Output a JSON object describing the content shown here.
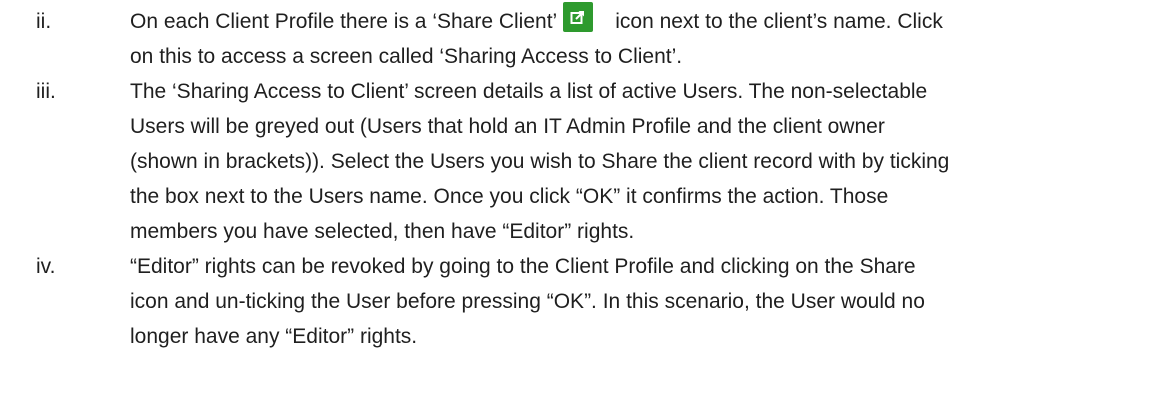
{
  "items": [
    {
      "numeral": "ii.",
      "lines": [
        {
          "before_icon": "On each Client Profile there is a ‘Share Client’",
          "icon": "share-icon",
          "after_icon": "icon next to the client’s name. Click"
        },
        "on this to access a screen called ‘Sharing Access to Client’."
      ]
    },
    {
      "numeral": "iii.",
      "lines": [
        "The ‘Sharing Access to Client’ screen details a list of active Users. The non-selectable",
        "Users will be greyed out (Users that hold an IT Admin Profile and the client owner",
        "(shown in brackets)). Select the Users you wish to Share the client record with by ticking",
        "the box next to the Users name. Once you click “OK” it confirms the action. Those",
        "members you have selected, then have “Editor” rights."
      ]
    },
    {
      "numeral": "iv.",
      "lines": [
        "“Editor” rights can be revoked by going to the Client Profile and clicking on the Share",
        "icon and un-ticking the User before pressing “OK”. In this scenario, the User would no",
        "longer have any “Editor” rights."
      ]
    }
  ],
  "colors": {
    "icon_background": "#2e9a2e",
    "text": "#1f1f1f"
  }
}
